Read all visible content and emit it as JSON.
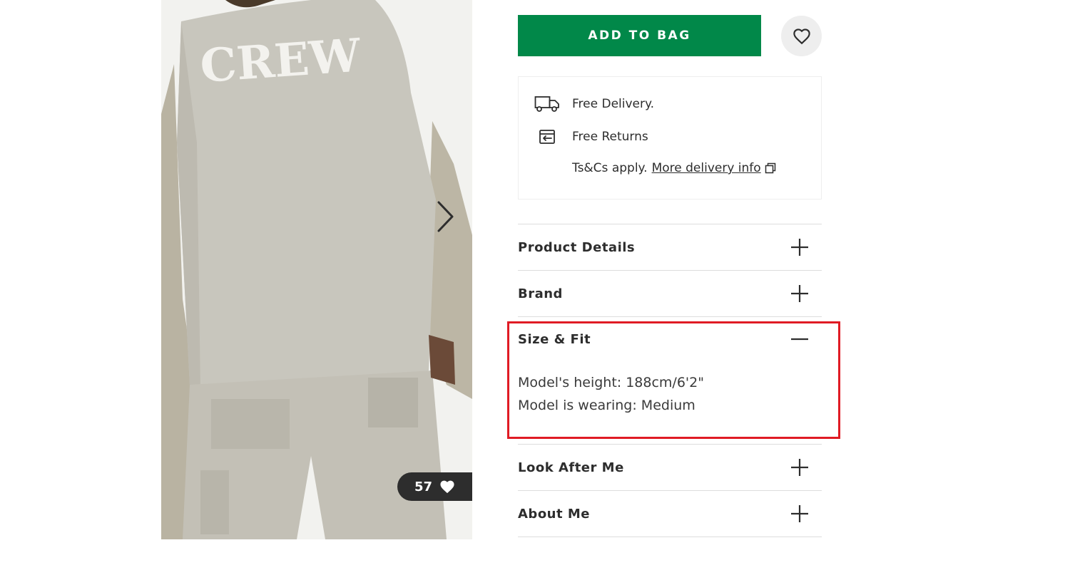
{
  "product": {
    "image_alt": "CREW",
    "saves_count": "57"
  },
  "actions": {
    "add_to_bag_label": "ADD TO BAG"
  },
  "delivery": {
    "free_delivery": "Free Delivery.",
    "free_returns": "Free Returns",
    "tscs_prefix": "Ts&Cs apply.",
    "more_info_link": "More delivery info"
  },
  "accordion": {
    "product_details": "Product Details",
    "brand": "Brand",
    "size_fit": "Size & Fit",
    "size_fit_lines": [
      "Model's height: 188cm/6'2\"",
      "Model is wearing: Medium"
    ],
    "look_after_me": "Look After Me",
    "about_me": "About Me"
  },
  "colors": {
    "primary_green": "#018849",
    "highlight_red": "#e01b24",
    "text": "#2d2d2d"
  }
}
